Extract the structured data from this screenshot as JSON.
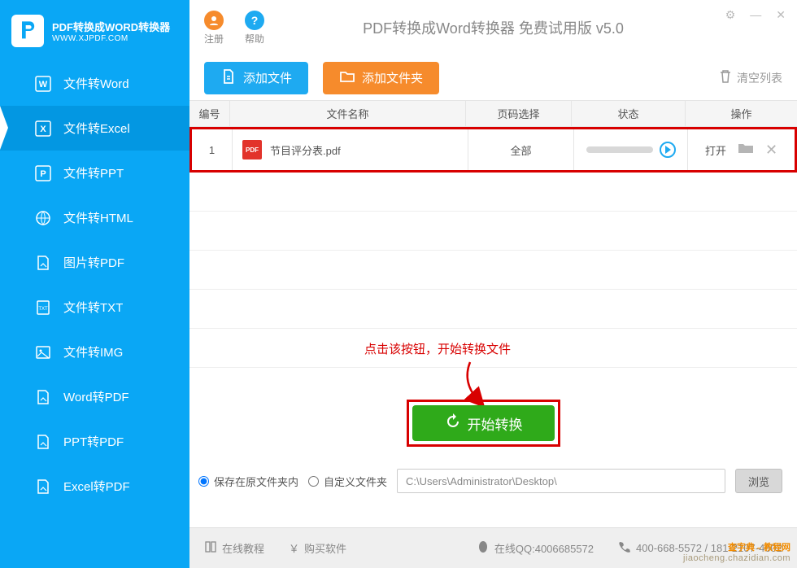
{
  "logo": {
    "line1": "PDF转换成WORD转换器",
    "line2": "WWW.XJPDF.COM"
  },
  "titlebar": {
    "register": "注册",
    "help": "帮助",
    "title": "PDF转换成Word转换器 免费试用版 v5.0"
  },
  "sidebar": {
    "items": [
      {
        "label": "文件转Word"
      },
      {
        "label": "文件转Excel"
      },
      {
        "label": "文件转PPT"
      },
      {
        "label": "文件转HTML"
      },
      {
        "label": "图片转PDF"
      },
      {
        "label": "文件转TXT"
      },
      {
        "label": "文件转IMG"
      },
      {
        "label": "Word转PDF"
      },
      {
        "label": "PPT转PDF"
      },
      {
        "label": "Excel转PDF"
      }
    ]
  },
  "toolbar": {
    "add_file": "添加文件",
    "add_folder": "添加文件夹",
    "clear_list": "清空列表"
  },
  "table": {
    "headers": {
      "num": "编号",
      "name": "文件名称",
      "page": "页码选择",
      "status": "状态",
      "op": "操作"
    },
    "rows": [
      {
        "num": "1",
        "name": "节目评分表.pdf",
        "page": "全部",
        "open": "打开"
      }
    ]
  },
  "annotation": "点击该按钮，开始转换文件",
  "start_button": "开始转换",
  "save": {
    "opt_same": "保存在原文件夹内",
    "opt_custom": "自定义文件夹",
    "path": "C:\\Users\\Administrator\\Desktop\\",
    "browse": "浏览"
  },
  "footer": {
    "tutorial": "在线教程",
    "buy": "购买软件",
    "qq_label": "在线QQ:4006685572",
    "phone": "400-668-5572 / 181-2107-4602"
  },
  "watermark": {
    "top": "查字典﹣教程网",
    "bot": "jiaocheng.chazidian.com"
  }
}
